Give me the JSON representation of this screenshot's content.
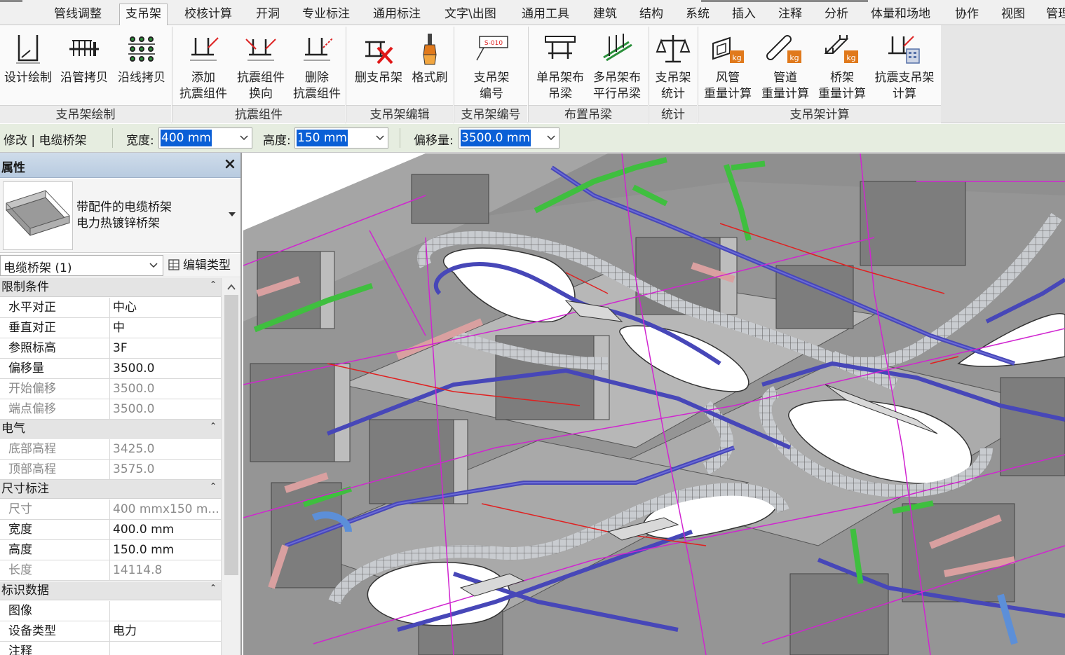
{
  "ribbon_tabs": [
    "管线调整",
    "支吊架",
    "校核计算",
    "开洞",
    "专业标注",
    "通用标注",
    "文字\\出图",
    "通用工具",
    "建筑",
    "结构",
    "系统",
    "插入",
    "注释",
    "分析",
    "体量和场地",
    "协作",
    "视图",
    "管理"
  ],
  "active_tab": "支吊架",
  "ribbon_buttons": {
    "design_draw": "设计绘制",
    "copy_along_pipe": "沿管拷贝",
    "copy_along_line": "沿线拷贝",
    "add_seismic_1": "添加",
    "add_seismic_2": "抗震组件",
    "flip_seismic_1": "抗震组件",
    "flip_seismic_2": "换向",
    "delete_seismic_1": "删除",
    "delete_seismic_2": "抗震组件",
    "delete_hanger": "删支吊架",
    "format_brush": "格式刷",
    "hanger_number_1": "支吊架",
    "hanger_number_2": "编号",
    "single_beam_1": "单吊架布",
    "single_beam_2": "吊梁",
    "multi_beam_1": "多吊架布",
    "multi_beam_2": "平行吊梁",
    "hanger_stats_1": "支吊架",
    "hanger_stats_2": "统计",
    "duct_weight_1": "风管",
    "duct_weight_2": "重量计算",
    "pipe_weight_1": "管道",
    "pipe_weight_2": "重量计算",
    "tray_weight_1": "桥架",
    "tray_weight_2": "重量计算",
    "seismic_calc_1": "抗震支吊架",
    "seismic_calc_2": "计算",
    "number_icon_text": "S-010"
  },
  "ribbon_groups": {
    "draw": "支吊架绘制",
    "seismic": "抗震组件",
    "edit": "支吊架编辑",
    "numbering": "支吊架编号",
    "beam": "布置吊梁",
    "stats": "统计",
    "calc": "支吊架计算"
  },
  "options_bar": {
    "context": "修改 | 电缆桥架",
    "width_label": "宽度:",
    "width_value": "400 mm",
    "height_label": "高度:",
    "height_value": "150 mm",
    "offset_label": "偏移量:",
    "offset_value": "3500.0 mm"
  },
  "properties": {
    "title": "属性",
    "type_name_1": "带配件的电缆桥架",
    "type_name_2": "电力热镀锌桥架",
    "instance_filter": "电缆桥架 (1)",
    "edit_type": "编辑类型",
    "sections": [
      {
        "name": "限制条件",
        "rows": [
          {
            "key": "水平对正",
            "value": "中心",
            "readonly": false
          },
          {
            "key": "垂直对正",
            "value": "中",
            "readonly": false
          },
          {
            "key": "参照标高",
            "value": "3F",
            "readonly": false
          },
          {
            "key": "偏移量",
            "value": "3500.0",
            "readonly": false
          },
          {
            "key": "开始偏移",
            "value": "3500.0",
            "readonly": true
          },
          {
            "key": "端点偏移",
            "value": "3500.0",
            "readonly": true
          }
        ]
      },
      {
        "name": "电气",
        "rows": [
          {
            "key": "底部高程",
            "value": "3425.0",
            "readonly": true
          },
          {
            "key": "顶部高程",
            "value": "3575.0",
            "readonly": true
          }
        ]
      },
      {
        "name": "尺寸标注",
        "rows": [
          {
            "key": "尺寸",
            "value": "400 mmx150 m...",
            "readonly": true
          },
          {
            "key": "宽度",
            "value": "400.0 mm",
            "readonly": false
          },
          {
            "key": "高度",
            "value": "150.0 mm",
            "readonly": false
          },
          {
            "key": "长度",
            "value": "14114.8",
            "readonly": true
          }
        ]
      },
      {
        "name": "标识数据",
        "rows": [
          {
            "key": "图像",
            "value": "",
            "readonly": false
          },
          {
            "key": "设备类型",
            "value": "电力",
            "readonly": false
          },
          {
            "key": "注释",
            "value": "",
            "readonly": false
          }
        ]
      }
    ]
  },
  "colors": {
    "cable_tray": "#4747b8",
    "pipe_green": "#3fbf3f",
    "duct_pink": "#d9a0a0",
    "line_magenta": "#d025d0",
    "line_red": "#e02020",
    "selection_blue": "#0a5fd6"
  }
}
